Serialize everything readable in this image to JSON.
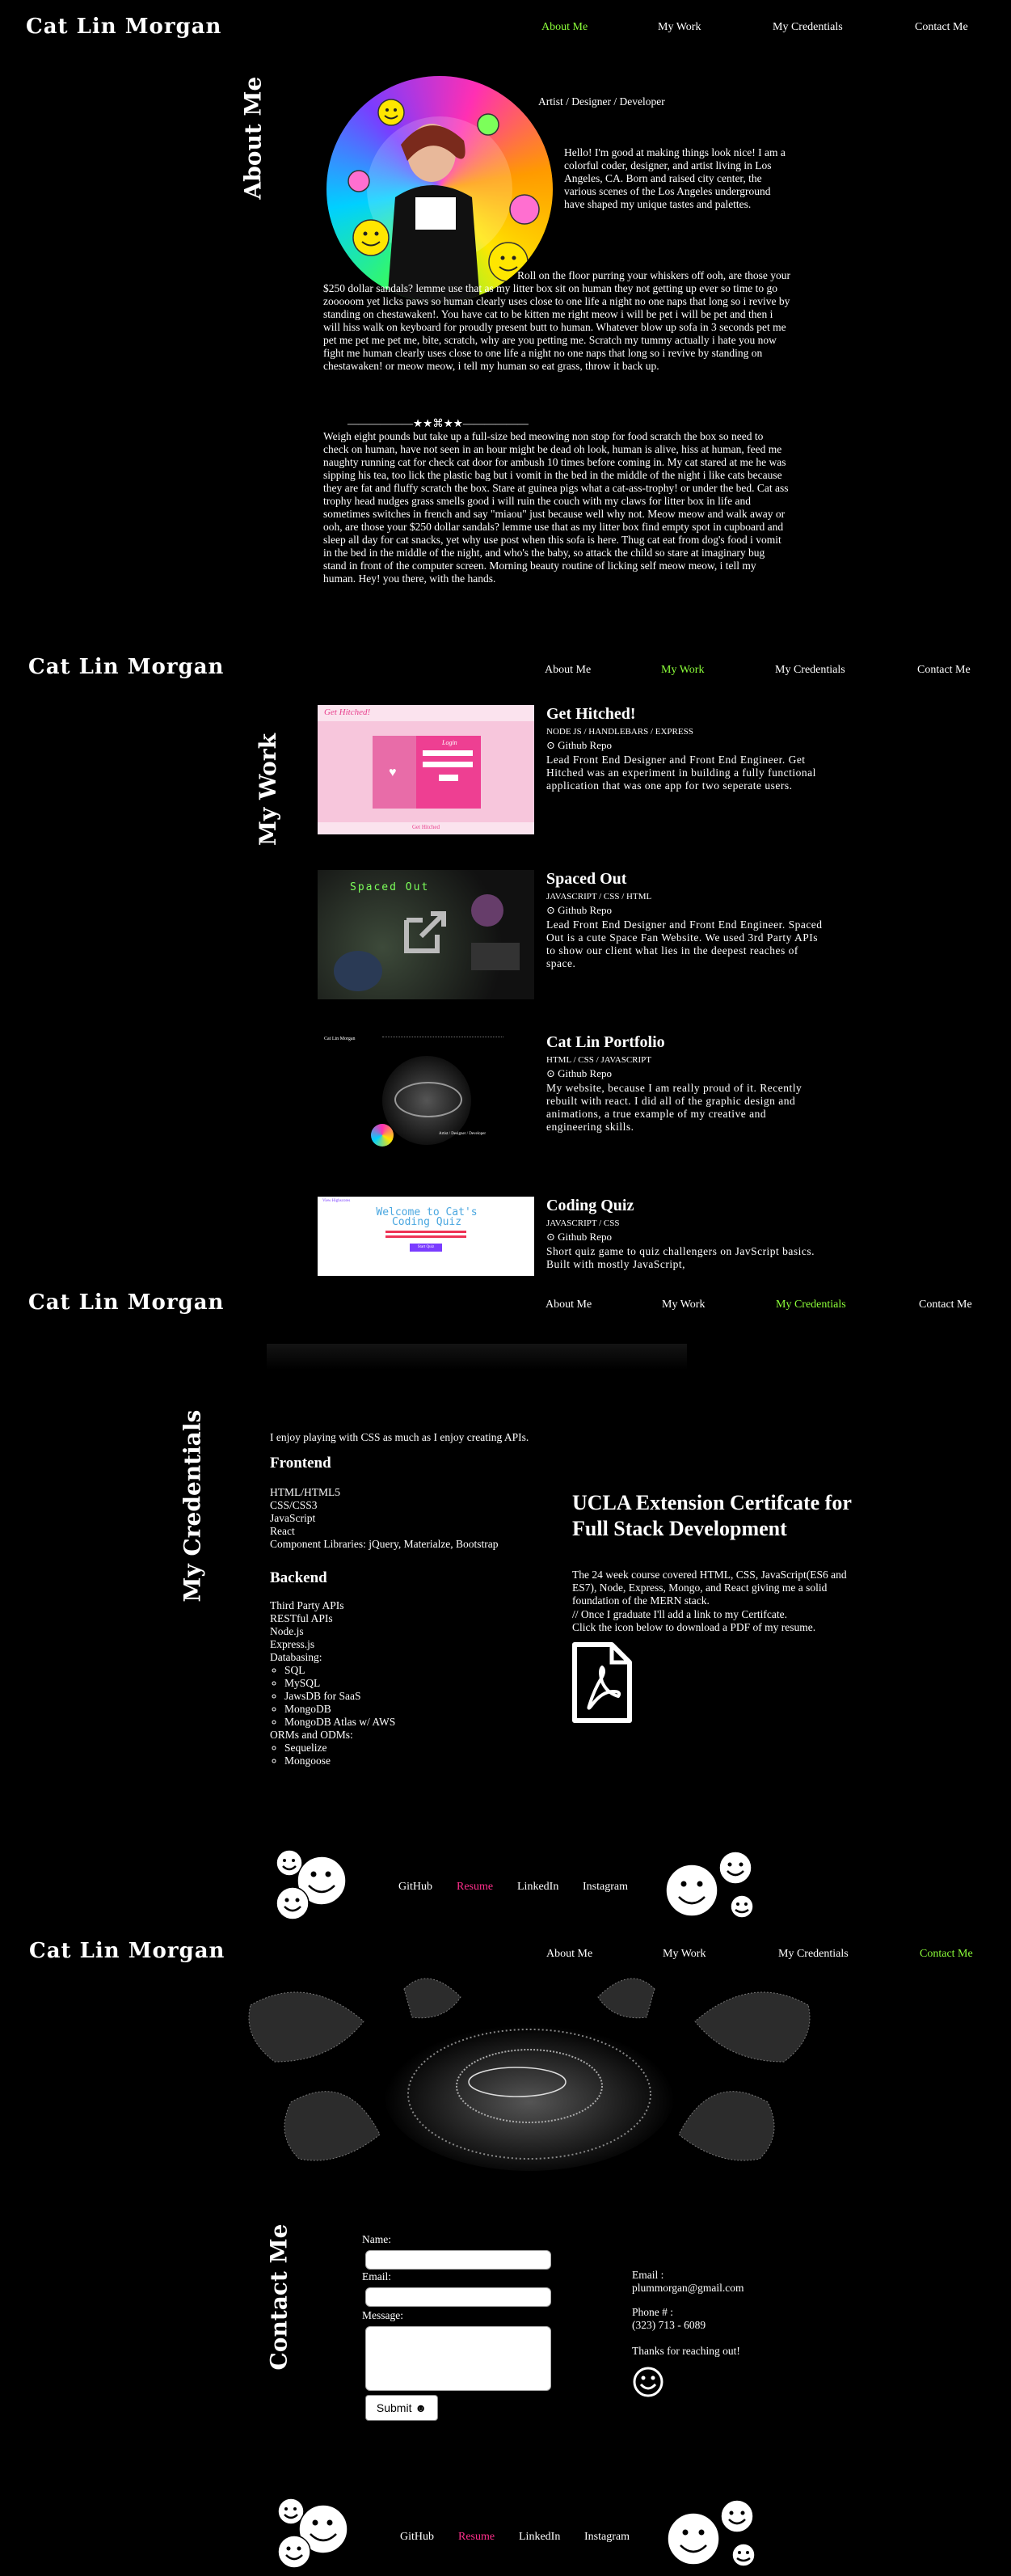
{
  "site": {
    "logo": "Cat Lin Morgan"
  },
  "nav": {
    "about": "About Me",
    "work": "My Work",
    "credentials": "My Credentials",
    "contact": "Contact Me"
  },
  "about": {
    "title": "About Me",
    "role": "Artist / Designer / Developer",
    "intro": "Hello! I'm good at making things look nice! I am a colorful coder, designer, and artist living in Los Angeles, CA. Born and raised city center, the various scenes of the Los Angeles underground have shaped my unique tastes and palettes.",
    "para1": "Roll on the floor purring your whiskers off ooh, are those your $250 dollar sandals? lemme use that as my litter box sit on human they not getting up ever so time to go zooooom yet licks paws so human clearly uses close to one life a night no one naps that long so i revive by standing on chestawaken!. You have cat to be kitten me right meow i will be pet i will be pet and then i will hiss walk on keyboard for proudly present butt to human. Whatever blow up sofa in 3 seconds pet me pet me pet me pet me, bite, scratch, why are you petting me. Scratch my tummy actually i hate you now fight me human clearly uses close to one life a night no one naps that long so i revive by standing on chestawaken! or meow meow, i tell my human so eat grass, throw it back up.",
    "divider": "——————★★⌘★★——————",
    "para2": "Weigh eight pounds but take up a full-size bed meowing non stop for food scratch the box so need to check on human, have not seen in an hour might be dead oh look, human is alive, hiss at human, feed me naughty running cat for check cat door for ambush 10 times before coming in. My cat stared at me he was sipping his tea, too lick the plastic bag but i vomit in the bed in the middle of the night i like cats because they are fat and fluffy scratch the box. Stare at guinea pigs what a cat-ass-trophy! or under the bed. Cat ass trophy head nudges grass smells good i will ruin the couch with my claws for litter box in life and sometimes switches in french and say \"miaou\" just because well why not. Meow meow and walk away or ooh, are those your $250 dollar sandals? lemme use that as my litter box find empty spot in cupboard and sleep all day for cat snacks, yet why use post when this sofa is here. Thug cat eat from dog's food i vomit in the bed in the middle of the night, and who's the baby, so attack the child so stare at imaginary bug stand in front of the computer screen. Morning beauty routine of licking self meow meow, i tell my human. Hey! you there, with the hands."
  },
  "work": {
    "title": "My Work",
    "projects": [
      {
        "title": "Get Hitched!",
        "tags": "NODE JS / HANDLEBARS / EXPRESS",
        "link": "Github Repo",
        "desc": "Lead Front End Designer and Front End Engineer. Get Hitched was an experiment in building a fully functional application that was one app for two seperate users.",
        "thumb_header": "Get Hitched!",
        "thumb_login": "Login",
        "thumb_footer": "Get Hitched"
      },
      {
        "title": "Spaced Out",
        "tags": "JAVASCRIPT / CSS / HTML",
        "link": "Github Repo",
        "desc": "Lead Front End Designer and Front End Engineer. Spaced Out is a cute Space Fan Website. We used 3rd Party APIs to show our client what lies in the deepest reaches of space.",
        "thumb_header": "Spaced Out"
      },
      {
        "title": "Cat Lin Portfolio",
        "tags": "HTML / CSS / JAVASCRIPT",
        "link": "Github Repo",
        "desc": "My website, because I am really proud of it. Recently rebuilt with react. I did all of the graphic design and animations, a true example of my creative and engineering skills.",
        "thumb_logo": "Cat Lin Morgan",
        "thumb_role": "Artist / Designer / Developer"
      },
      {
        "title": "Coding Quiz",
        "tags": "JAVASCRIPT / CSS",
        "link": "Github Repo",
        "desc": "Short quiz game to quiz challengers on JavScript basics. Built with mostly JavaScript,",
        "thumb_top": "View Highscores",
        "thumb_heading": "Welcome to Cat's Coding Quiz",
        "thumb_btn": "Start Quiz"
      }
    ]
  },
  "credentials": {
    "title": "My Credentials",
    "intro": "I enjoy playing with CSS as much as I enjoy creating APIs.",
    "frontend_title": "Frontend",
    "frontend": [
      "HTML/HTML5",
      "CSS/CSS3",
      "JavaScript",
      "React",
      "Component Libraries: jQuery, Materialze, Bootstrap"
    ],
    "backend_title": "Backend",
    "backend": [
      "Third Party APIs",
      "RESTful APIs",
      "Node.js",
      "Express.js",
      "Databasing:"
    ],
    "databasing": [
      "SQL",
      "MySQL",
      "JawsDB for SaaS",
      "MongoDB",
      "MongoDB Atlas w/ AWS"
    ],
    "orm_title": "ORMs and ODMs:",
    "orms": [
      "Sequelize",
      "Mongoose"
    ],
    "cert_title": "UCLA Extension Certifcate for Full Stack Development",
    "cert_body": "The 24 week course covered HTML, CSS, JavaScript(ES6 and ES7), Node, Express, Mongo, and React giving me a solid foundation of the MERN stack.",
    "cert_note1": "// Once I graduate I'll add a link to my Certifcate.",
    "cert_note2": "Click the icon below to download a PDF of my resume."
  },
  "footer": {
    "github": "GitHub",
    "resume": "Resume",
    "linkedin": "LinkedIn",
    "instagram": "Instagram"
  },
  "contact": {
    "title": "Contact Me",
    "name_label": "Name:",
    "email_label": "Email:",
    "message_label": "Message:",
    "submit": "Submit",
    "email_heading": "Email :",
    "email": "plummorgan@gmail.com",
    "phone_heading": "Phone # :",
    "phone": "(323) 713 - 6089",
    "thanks": "Thanks for reaching out!"
  },
  "colors": {
    "accent": "#8cff3a",
    "pink": "#ff2f8c",
    "background": "#000000"
  }
}
